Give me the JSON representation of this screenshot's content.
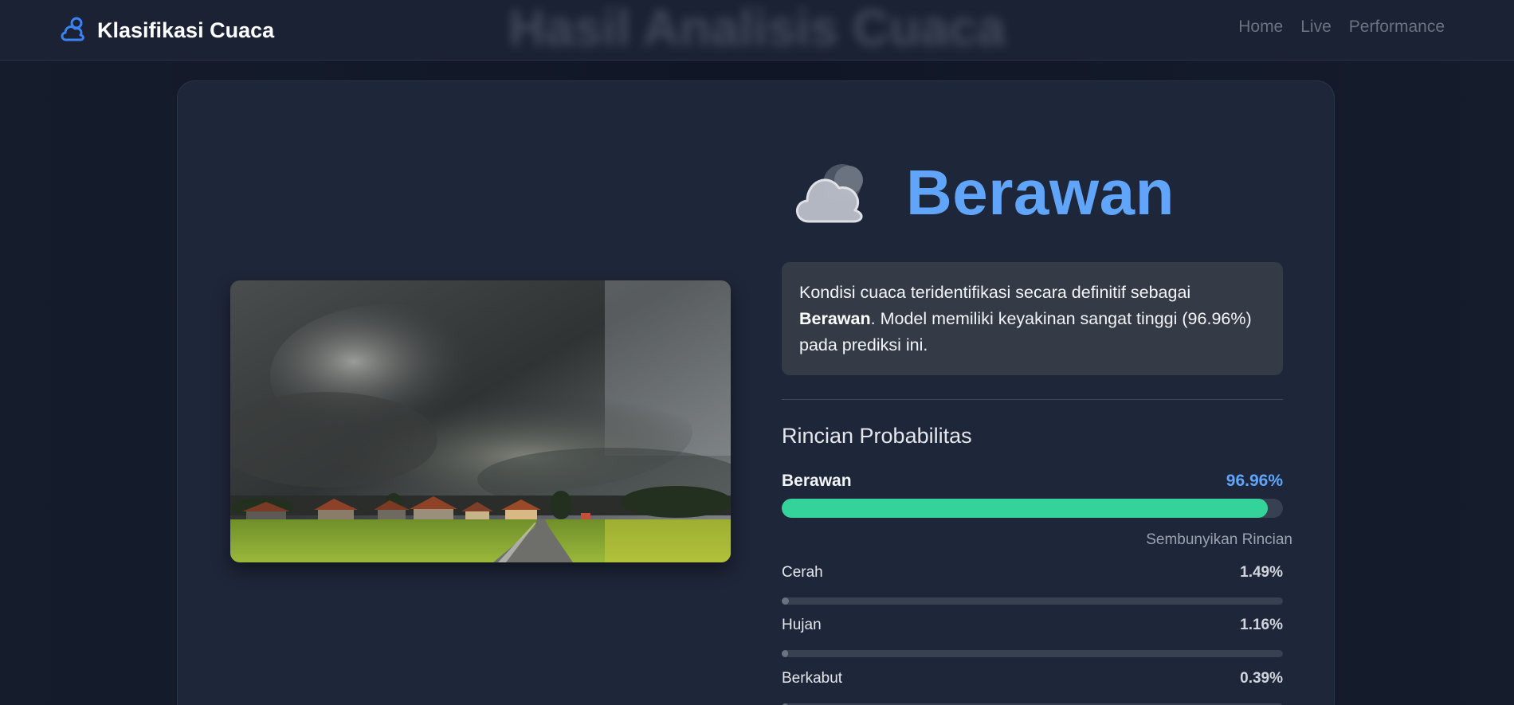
{
  "navbar": {
    "brand_name": "Klasifikasi Cuaca",
    "ghost_title": "Hasil Analisis Cuaca",
    "links": [
      {
        "label": "Home"
      },
      {
        "label": "Live"
      },
      {
        "label": "Performance"
      }
    ]
  },
  "result": {
    "label": "Berawan",
    "icon": "cloud-moon-icon",
    "description_prefix": "Kondisi cuaca teridentifikasi secara definitif sebagai ",
    "description_label": "Berawan",
    "description_suffix": ". Model memiliki keyakinan sangat tinggi (96.96%) pada prediksi ini."
  },
  "breakdown": {
    "title": "Rincian Probabilitas",
    "top": {
      "name": "Berawan",
      "percent_text": "96.96%",
      "value": 96.96
    },
    "toggle_label": "Sembunyikan Rincian",
    "items": [
      {
        "name": "Cerah",
        "percent_text": "1.49%",
        "value": 1.49
      },
      {
        "name": "Hujan",
        "percent_text": "1.16%",
        "value": 1.16
      },
      {
        "name": "Berkabut",
        "percent_text": "0.39%",
        "value": 0.39
      }
    ]
  },
  "colors": {
    "accent": "#60a5fa",
    "bar_fill": "#34d399",
    "sub_bar_fill": "#6b7280",
    "track": "#374151"
  }
}
